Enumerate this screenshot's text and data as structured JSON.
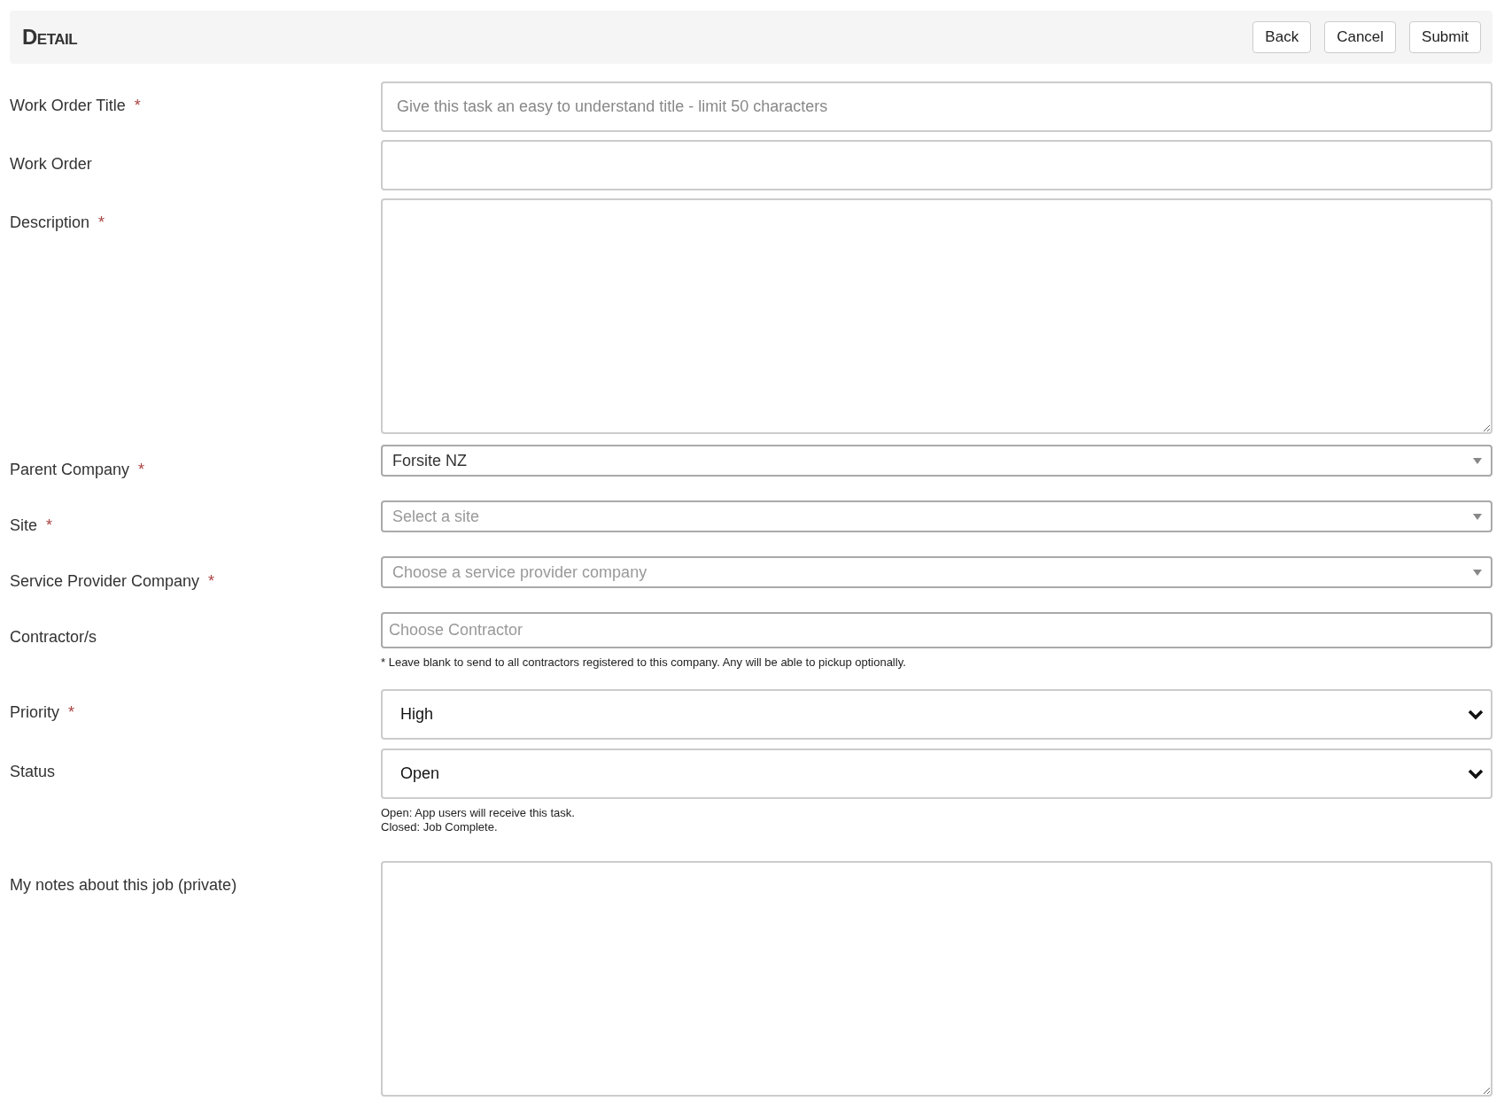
{
  "header": {
    "title": "Detail",
    "buttons": [
      "Back",
      "Cancel",
      "Submit"
    ]
  },
  "fields": [
    {
      "kind": "text",
      "label": "Work Order Title",
      "required_mark": "*",
      "placeholder": "Give this task an easy to understand title - limit 50 characters"
    },
    {
      "kind": "text",
      "label": "Work Order"
    },
    {
      "kind": "textarea",
      "label": "Description",
      "required_mark": "*"
    },
    {
      "kind": "combo",
      "label": "Parent Company",
      "required_mark": "*",
      "value": "Forsite NZ"
    },
    {
      "kind": "combo",
      "label": "Site",
      "required_mark": "*",
      "placeholder": "Select a site"
    },
    {
      "kind": "combo",
      "label": "Service Provider Company",
      "required_mark": "*",
      "placeholder": "Choose a service provider company"
    },
    {
      "kind": "tags",
      "label": "Contractor/s",
      "placeholder": "Choose Contractor",
      "hint": [
        "* Leave blank to send to all contractors registered to this company. Any will be able to pickup optionally."
      ]
    },
    {
      "kind": "select",
      "label": "Priority",
      "required_mark": "*",
      "value": "High"
    },
    {
      "kind": "select",
      "label": "Status",
      "value": "Open",
      "hint": [
        "Open: App users will receive this task.",
        "Closed: Job Complete."
      ]
    },
    {
      "kind": "textarea",
      "label": "My notes about this job (private)"
    }
  ]
}
